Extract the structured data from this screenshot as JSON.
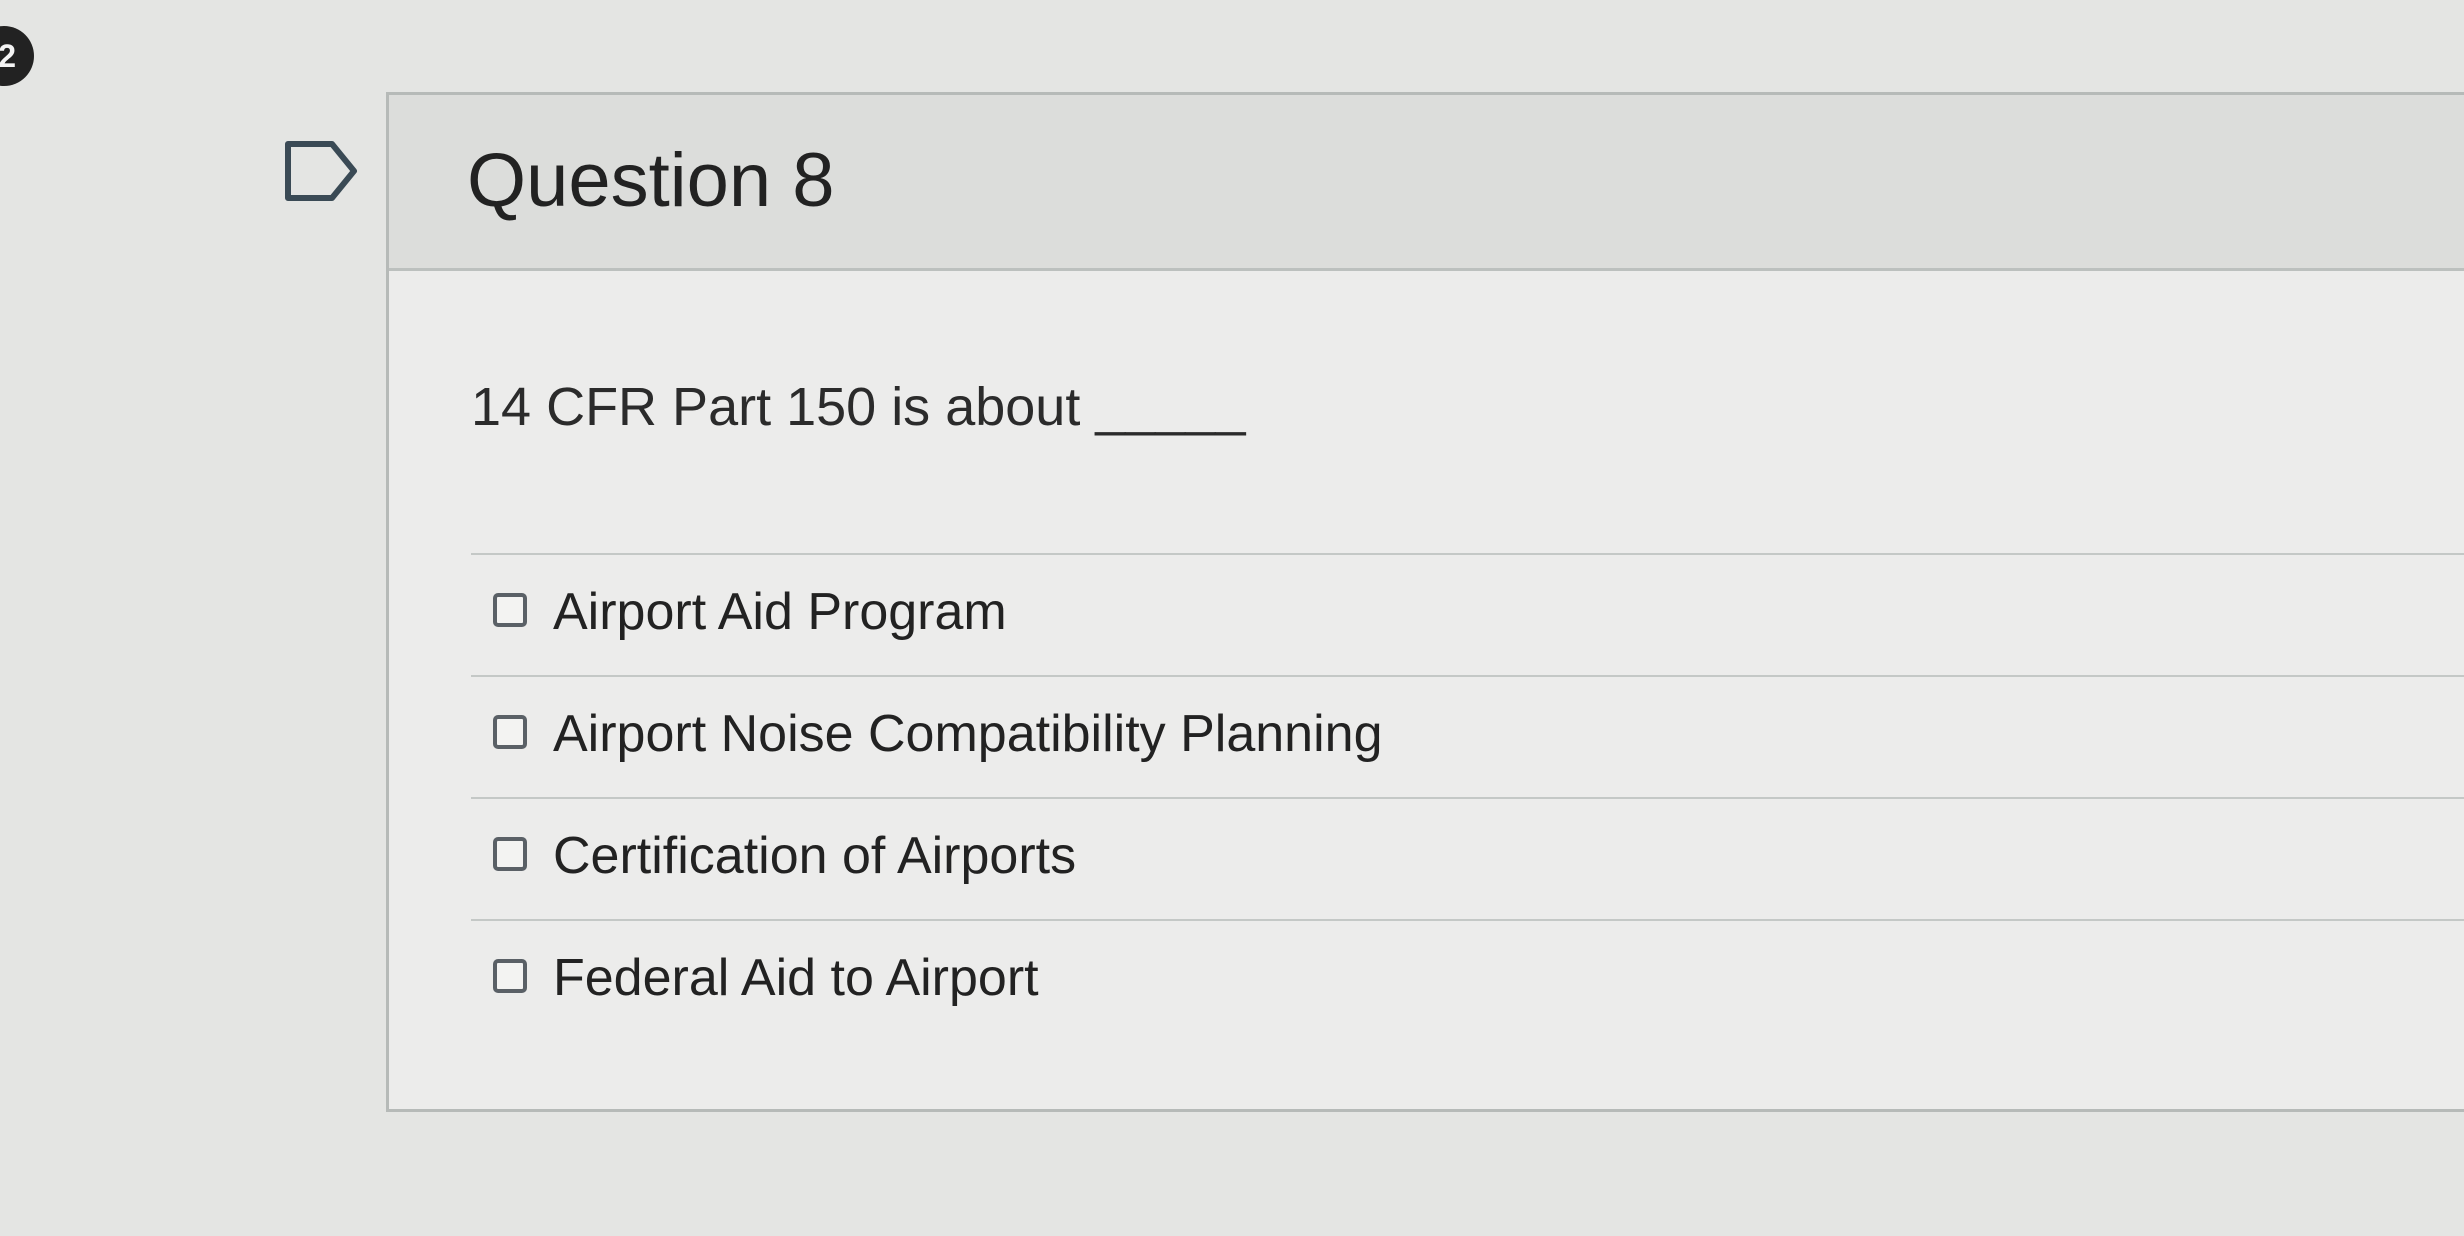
{
  "badge": {
    "number": "2"
  },
  "question": {
    "title": "Question 8",
    "text": "14 CFR Part 150 is about _____"
  },
  "answers": [
    {
      "label": "Airport Aid Program"
    },
    {
      "label": "Airport Noise Compatibility Planning"
    },
    {
      "label": "Certification of Airports"
    },
    {
      "label": "Federal Aid to Airport"
    }
  ],
  "icons": {
    "flag": "flag-outline-icon",
    "checkbox": "checkbox-unchecked-icon"
  },
  "colors": {
    "background": "#e4e5e3",
    "header": "#dcdddb",
    "card": "#ececeb"
  }
}
